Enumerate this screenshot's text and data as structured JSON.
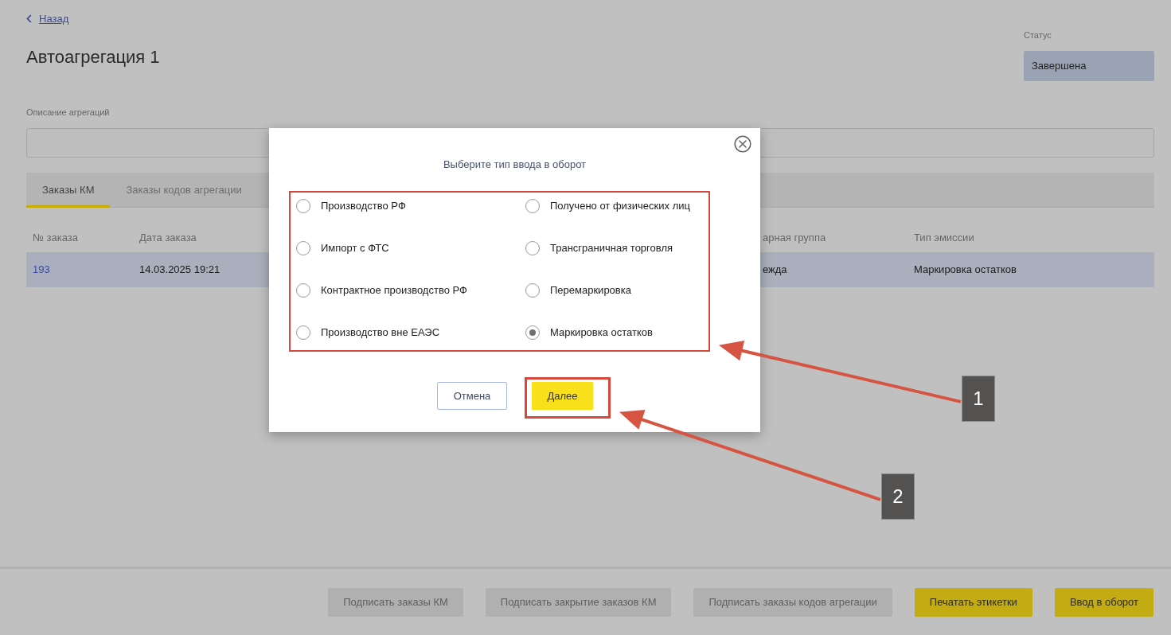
{
  "back_link": {
    "label": "Назад"
  },
  "title": "Автоагрегация 1",
  "status": {
    "label": "Статус",
    "value": "Завершена"
  },
  "description": {
    "label": "Описание агрегаций"
  },
  "tabs": [
    {
      "label": "Заказы КМ",
      "selected": true
    },
    {
      "label": "Заказы кодов агрегации",
      "selected": false
    }
  ],
  "table": {
    "columns": [
      "№ заказа",
      "Дата заказа",
      "арная группа",
      "Тип эмиссии"
    ],
    "rows": [
      [
        "193",
        "14.03.2025 19:21",
        "ежда",
        "Маркировка остатков"
      ]
    ]
  },
  "footer_buttons": [
    {
      "label": "Подписать заказы КМ",
      "disabled": true
    },
    {
      "label": "Подписать закрытие заказов КМ",
      "disabled": true
    },
    {
      "label": "Подписать заказы кодов агрегации",
      "disabled": true
    },
    {
      "label": "Печатать этикетки",
      "disabled": false
    },
    {
      "label": "Ввод в оборот",
      "disabled": false
    }
  ],
  "dialog": {
    "title": "Выберите тип ввода в оборот",
    "options_highlighted": true,
    "options": [
      {
        "label": "Производство РФ",
        "selected": false
      },
      {
        "label": "Получено от физических лиц",
        "selected": false
      },
      {
        "label": "Импорт с ФТС",
        "selected": false
      },
      {
        "label": "Трансграничная торговля",
        "selected": false
      },
      {
        "label": "Контрактное производство РФ",
        "selected": false
      },
      {
        "label": "Перемаркировка",
        "selected": false
      },
      {
        "label": "Производство вне ЕАЭС",
        "selected": false
      },
      {
        "label": "Маркировка остатков",
        "selected": true
      }
    ],
    "buttons": [
      {
        "label": "Отмена",
        "kind": "secondary",
        "highlighted": false
      },
      {
        "label": "Далее",
        "kind": "primary",
        "highlighted": true
      }
    ]
  },
  "callouts": [
    {
      "label": "1"
    },
    {
      "label": "2"
    }
  ]
}
